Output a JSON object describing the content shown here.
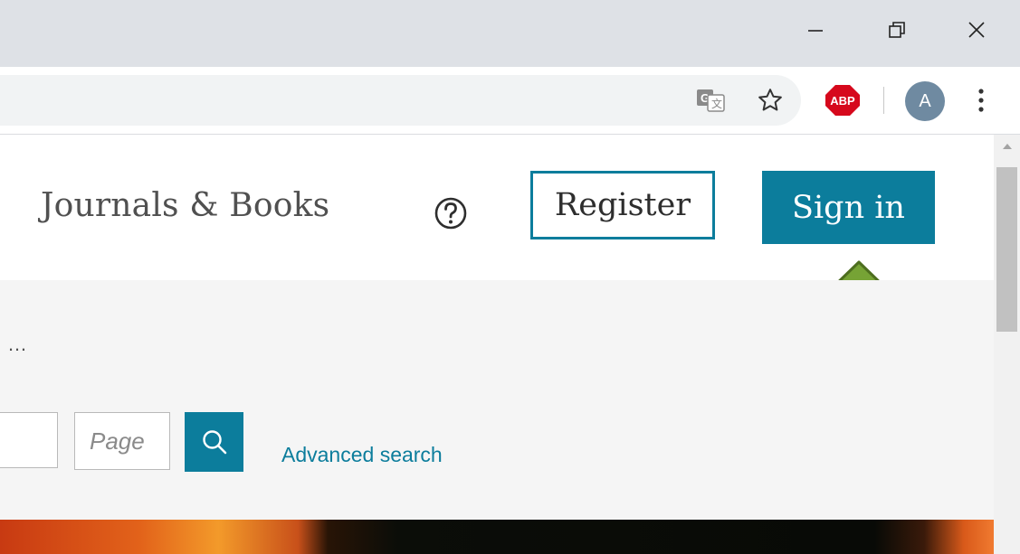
{
  "window": {
    "minimize_icon": "minimize-icon",
    "restore_icon": "restore-icon",
    "close_icon": "close-icon"
  },
  "toolbar": {
    "translate_icon": "translate-icon",
    "bookmark_icon": "star-icon",
    "adblock_label": "ABP",
    "profile_initial": "A",
    "menu_icon": "more-vert-icon"
  },
  "header": {
    "nav_journals_books": "Journals & Books",
    "help_icon": "help-icon",
    "register_label": "Register",
    "signin_label": "Sign in",
    "annotation": "up-arrow-icon"
  },
  "search": {
    "truncated_text": "…",
    "page_placeholder": "Page",
    "search_icon": "search-icon",
    "advanced_search_label": "Advanced search"
  },
  "colors": {
    "brand": "#0c7d9c",
    "arrow_fill": "#76a335",
    "abp_red": "#d6081c"
  }
}
